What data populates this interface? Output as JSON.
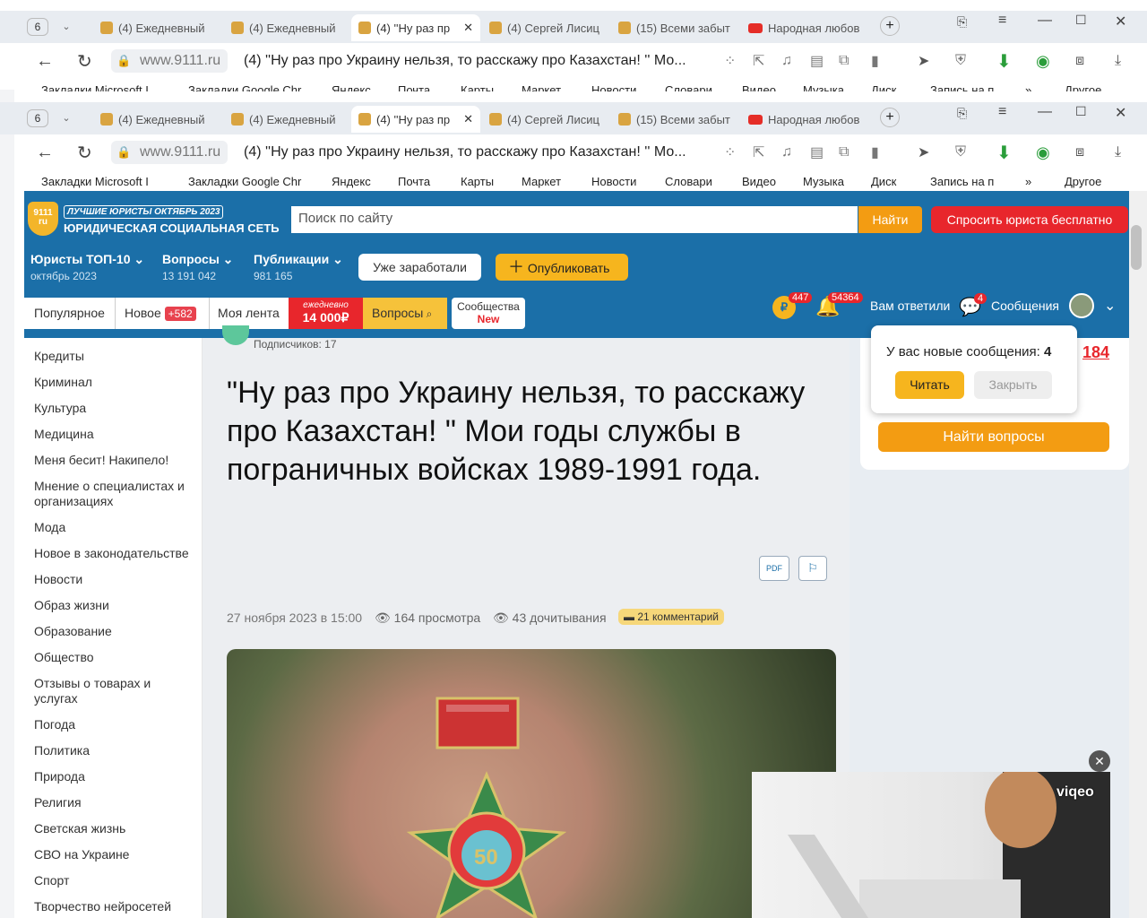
{
  "browser": {
    "tab_count": "6",
    "tabs": [
      {
        "label": "(4) Ежедневный"
      },
      {
        "label": "(4) Ежедневный"
      },
      {
        "label": "(4) ''Ну раз пр"
      },
      {
        "label": "(4) Сергей Лисиц"
      },
      {
        "label": "(15) Всеми забыт"
      },
      {
        "label": "Народная любов"
      }
    ],
    "url_host": "www.9111.ru",
    "page_title": "(4) ''Ну раз про Украину нельзя, то расскажу про Казахстан! '' Мо...",
    "bookmarks": [
      "Закладки Microsoft I",
      "Закладки Google Chr",
      "Яндекс",
      "Почта",
      "Карты",
      "Маркет",
      "Новости",
      "Словари",
      "Видео",
      "Музыка",
      "Диск",
      "Запись на п",
      "»",
      "Другое"
    ]
  },
  "site": {
    "logo_text": "9111\nru",
    "tagline": "ЛУЧШИЕ ЮРИСТЫ ОКТЯБРЬ 2023",
    "name": "ЮРИДИЧЕСКАЯ СОЦИАЛЬНАЯ СЕТЬ",
    "search_placeholder": "Поиск по сайту",
    "search_button": "Найти",
    "ask_button": "Спросить юриста бесплатно",
    "nav": [
      {
        "title": "Юристы ТОП-10",
        "sub": "октябрь 2023"
      },
      {
        "title": "Вопросы",
        "sub": "13 191 042"
      },
      {
        "title": "Публикации",
        "sub": "981 165"
      }
    ],
    "earned_button": "Уже заработали",
    "publish_button": "Опубликовать",
    "tabs": {
      "popular": "Популярное",
      "new": "Новое",
      "new_badge": "+582",
      "feed": "Моя лента",
      "daily_top": "ежедневно",
      "daily_sum": "14 000₽",
      "questions": "Вопросы",
      "communities": "Сообщества",
      "communities_new": "New"
    },
    "user_bar": {
      "ruble_count": "447",
      "bell_count": "54364",
      "answered": "Вам ответили",
      "msg_count": "4",
      "messages": "Сообщения"
    }
  },
  "sidebar_menu": [
    "Кредиты",
    "Криминал",
    "Культура",
    "Медицина",
    "Меня бесит! Накипело!",
    "Мнение о специалистах и организациях",
    "Мода",
    "Новое в законодательстве",
    "Новости",
    "Образ жизни",
    "Образование",
    "Общество",
    "Отзывы о товарах и услугах",
    "Погода",
    "Политика",
    "Природа",
    "Религия",
    "Светская жизнь",
    "СВО на Украине",
    "Спорт",
    "Творчество нейросетей"
  ],
  "article": {
    "subscribers": "Подписчиков: 17",
    "title": "\"Ну раз про Украину нельзя, то расскажу про Казахстан! \" Мои годы службы в пограничных войсках 1989-1991 года.",
    "date": "27 ноября 2023 в 15:00",
    "views": "164 просмотра",
    "reads": "43 дочитывания",
    "comments": "21 комментарий",
    "pdf_label": "PDF"
  },
  "popup": {
    "text": "У вас новые сообщения:",
    "count": "4",
    "read_button": "Читать",
    "close_button": "Закрыть"
  },
  "right_panel": {
    "number": "184",
    "find_button": "Найти вопросы"
  },
  "video": {
    "brand": "viqeo"
  }
}
